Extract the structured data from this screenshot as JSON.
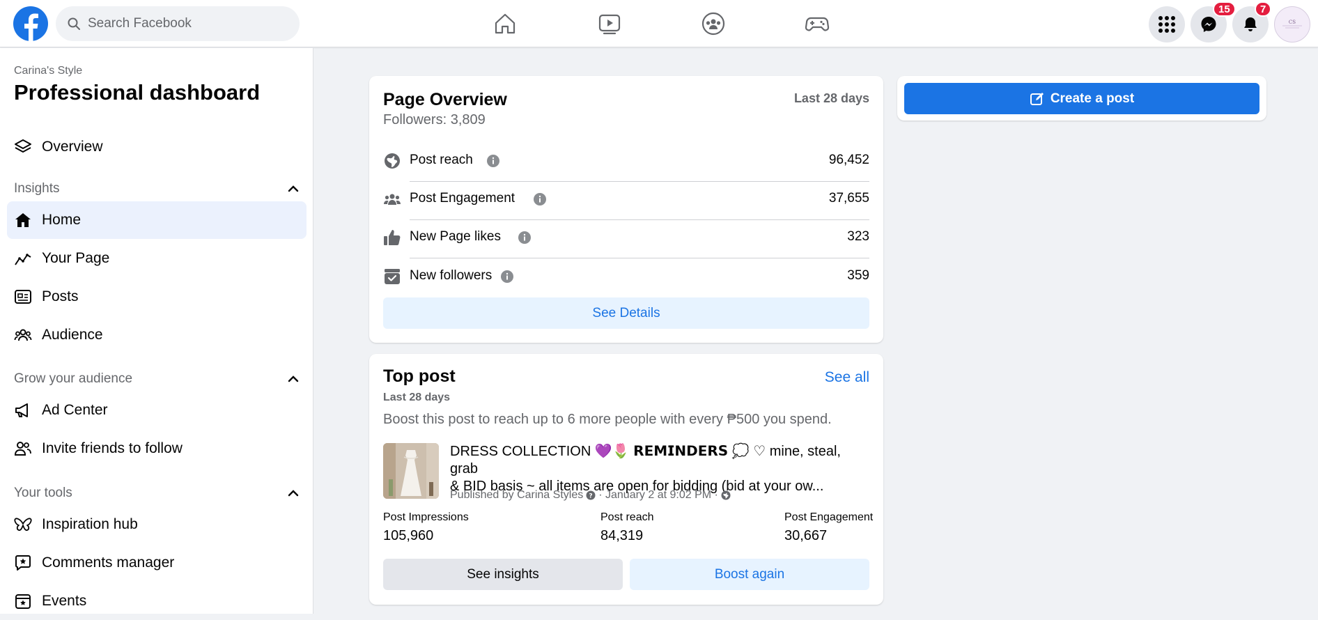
{
  "topbar": {
    "search_placeholder": "Search Facebook",
    "messenger_badge": "15",
    "notifications_badge": "7",
    "accent": "#1b74e4",
    "badge_color": "#e41e3f"
  },
  "sidebar": {
    "page_name": "Carina's Style",
    "title": "Professional dashboard",
    "overview": "Overview",
    "insights_label": "Insights",
    "insights_items": [
      "Home",
      "Your Page",
      "Posts",
      "Audience"
    ],
    "grow_label": "Grow your audience",
    "grow_items": [
      "Ad Center",
      "Invite friends to follow"
    ],
    "tools_label": "Your tools",
    "tools_items": [
      "Inspiration hub",
      "Comments manager",
      "Events"
    ]
  },
  "overview": {
    "title": "Page Overview",
    "range": "Last 28 days",
    "followers": "Followers: 3,809",
    "metrics": [
      {
        "label": "Post reach",
        "value": "96,452",
        "icon": "globe-icon"
      },
      {
        "label": "Post Engagement",
        "value": "37,655",
        "icon": "people-icon"
      },
      {
        "label": "New Page likes",
        "value": "323",
        "icon": "thumbs-up-icon"
      },
      {
        "label": "New followers",
        "value": "359",
        "icon": "follower-box-icon"
      }
    ],
    "details_button": "See Details"
  },
  "create_post": {
    "label": "Create a post"
  },
  "top_post": {
    "title": "Top post",
    "see_all": "See all",
    "range": "Last 28 days",
    "boost_text": "Boost this post to reach up to 6 more people with every ₱500 you spend.",
    "post_text_1": "DRESS COLLECTION 💜🌷 𝗥𝗘𝗠𝗜𝗡𝗗𝗘𝗥𝗦 💭 ♡ mine, steal, grab",
    "post_text_2": "& BID basis ~ all items are open for bidding (bid at your ow...",
    "published_by": "Published by Carina Styles",
    "published_date": "· January 2 at 9:02 PM ·",
    "stats": [
      {
        "label": "Post Impressions",
        "value": "105,960"
      },
      {
        "label": "Post reach",
        "value": "84,319"
      },
      {
        "label": "Post Engagement",
        "value": "30,667"
      }
    ],
    "insights_button": "See insights",
    "boost_button": "Boost again"
  }
}
